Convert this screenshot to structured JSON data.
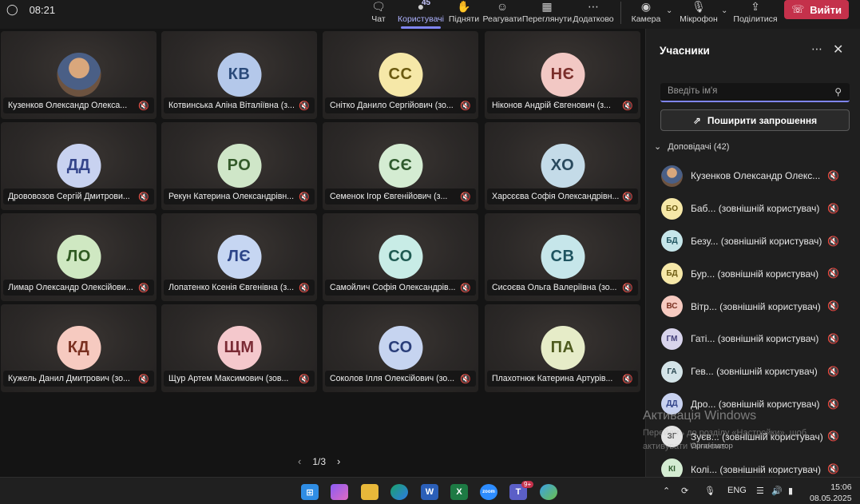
{
  "timer": "08:21",
  "toolbar": {
    "chat": "Чат",
    "people": "Користувачі",
    "people_count": "45",
    "raise": "Підняти",
    "react": "Реагувати",
    "view": "Переглянути",
    "apps": "Додатково",
    "camera": "Камера",
    "mic": "Мікрофон",
    "share": "Поділитися",
    "leave": "Вийти"
  },
  "tiles": [
    {
      "initials": "",
      "photo": true,
      "name": "Кузенков Олександр Олекса...",
      "bg": "",
      "fg": ""
    },
    {
      "initials": "КВ",
      "name": "Котвинська Аліна Віталіївна (з...",
      "bg": "#b4c8ea",
      "fg": "#2a4a7a"
    },
    {
      "initials": "СС",
      "name": "Снітко Данило Сергійович (зо...",
      "bg": "#f6e8a8",
      "fg": "#6b5a10"
    },
    {
      "initials": "НЄ",
      "name": "Ніконов Андрій Євгенович (з...",
      "bg": "#f2c8c4",
      "fg": "#7a2e2a"
    },
    {
      "initials": "ДД",
      "name": "Дрововозов Сергій Дмитрови...",
      "bg": "#c8d2f0",
      "fg": "#33448a"
    },
    {
      "initials": "РО",
      "name": "Рекун Катерина Олександрівн...",
      "bg": "#cfe6c8",
      "fg": "#335a2a"
    },
    {
      "initials": "СЄ",
      "name": "Семенок Ігор Євгенійович (з...",
      "bg": "#d4ecd2",
      "fg": "#2e5a2c"
    },
    {
      "initials": "ХО",
      "name": "Харсєєва Софія Олександрівн...",
      "bg": "#c4dbe8",
      "fg": "#2a4a5e"
    },
    {
      "initials": "ЛО",
      "name": "Лимар Олександр Олексійови...",
      "bg": "#cfe8c2",
      "fg": "#2f5a22"
    },
    {
      "initials": "ЛЄ",
      "name": "Лопатенко Ксенія Євгенівна (з...",
      "bg": "#c6d6f2",
      "fg": "#2c4488"
    },
    {
      "initials": "СО",
      "name": "Самойлич Софія Олександрів...",
      "bg": "#c8ece6",
      "fg": "#1f5a52"
    },
    {
      "initials": "СВ",
      "name": "Сисоєва Ольга Валеріївна (зо...",
      "bg": "#c6e6ea",
      "fg": "#1f5460"
    },
    {
      "initials": "КД",
      "name": "Кужель Данил Дмитрович (зо...",
      "bg": "#f6cac0",
      "fg": "#7a3020"
    },
    {
      "initials": "ЩМ",
      "name": "Щур Артем Максимович (зов...",
      "bg": "#f4c8cc",
      "fg": "#7a2a34"
    },
    {
      "initials": "СО",
      "name": "Соколов Ілля Олексійович (зо...",
      "bg": "#c6d4f0",
      "fg": "#2a3e7a"
    },
    {
      "initials": "ПА",
      "name": "Плахотнюк Катерина Артурів...",
      "bg": "#e6ecc8",
      "fg": "#4e5a1e"
    }
  ],
  "pager": "1/3",
  "panel": {
    "title": "Учасники",
    "search_placeholder": "Введіть ім'я",
    "invite": "Поширити запрошення",
    "section": "Доповідачі (42)",
    "people": [
      {
        "initials": "",
        "photo": true,
        "name": "Кузенков Олександр Олекс...",
        "bg": "",
        "fg": ""
      },
      {
        "initials": "БО",
        "name": "Баб... (зовнішній користувач)",
        "bg": "#f6e8a8",
        "fg": "#6b5a10"
      },
      {
        "initials": "БД",
        "name": "Безу... (зовнішній користувач)",
        "bg": "#c6e6ea",
        "fg": "#1f5460"
      },
      {
        "initials": "БД",
        "name": "Бур... (зовнішній користувач)",
        "bg": "#f6e8a8",
        "fg": "#6b5a10"
      },
      {
        "initials": "ВС",
        "name": "Вітр... (зовнішній користувач)",
        "bg": "#f6cac0",
        "fg": "#7a3020"
      },
      {
        "initials": "ГМ",
        "name": "Гаті... (зовнішній користувач)",
        "bg": "#d8d4ec",
        "fg": "#44407a"
      },
      {
        "initials": "ГА",
        "name": "Гев... (зовнішній користувач)",
        "bg": "#d4e4e8",
        "fg": "#2c4a52"
      },
      {
        "initials": "ДД",
        "name": "Дро... (зовнішній користувач)",
        "bg": "#c8d2f0",
        "fg": "#33448a"
      },
      {
        "initials": "ЗГ",
        "name": "Зуєв... (зовнішній користувач)",
        "bg": "#e4e4e4",
        "fg": "#555555",
        "sub": "Організатор"
      },
      {
        "initials": "КІ",
        "name": "Колі... (зовнішній користувач)",
        "bg": "#d4ecd2",
        "fg": "#2e5a2c"
      }
    ]
  },
  "watermark": {
    "title": "Активація Windows",
    "line1": "Перейдіть до розділу «Настройки», щоб",
    "line2": "активувати Windows."
  },
  "taskbar": {
    "teams_badge": "9+",
    "lang": "ENG",
    "time": "15:06",
    "date": "08.05.2025"
  }
}
